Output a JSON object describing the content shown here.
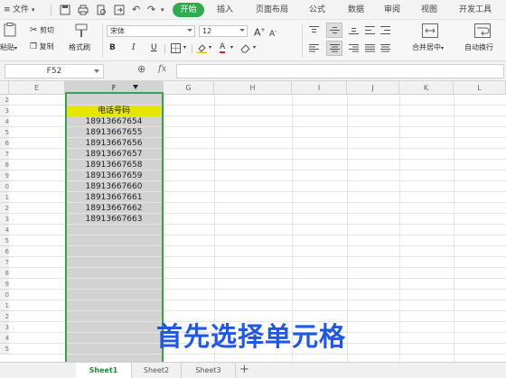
{
  "menubar": {
    "file": "文件",
    "tabs": [
      "开始",
      "插入",
      "页面布局",
      "公式",
      "数据",
      "审阅",
      "视图",
      "开发工具"
    ],
    "active_tab": "开始"
  },
  "ribbon": {
    "paste": "粘贴",
    "cut": "剪切",
    "copy": "复制",
    "format_painter": "格式刷",
    "font_name": "宋体",
    "font_size": "12",
    "grow_font": "A",
    "shrink_font": "A",
    "bold": "B",
    "italic": "I",
    "underline": "U",
    "font_color_label": "A",
    "merge_center": "合并居中",
    "auto_wrap": "自动换行"
  },
  "formula_bar": {
    "name_box": "F52",
    "fx": "fx",
    "formula": ""
  },
  "columns": [
    "E",
    "F",
    "G",
    "H",
    "I",
    "J",
    "K",
    "L"
  ],
  "selected_column": "F",
  "row_numbers": [
    "2",
    "3",
    "4",
    "5",
    "6",
    "7",
    "8",
    "9",
    "0",
    "1",
    "2",
    "3",
    "4",
    "5",
    "6",
    "7",
    "8",
    "9",
    "0",
    "1",
    "2",
    "3",
    "4",
    "5"
  ],
  "table": {
    "header": "电话号码",
    "phones": [
      "18913667654",
      "18913667655",
      "18913667656",
      "18913667657",
      "18913667658",
      "18913667659",
      "18913667660",
      "18913667661",
      "18913667662",
      "18913667663"
    ]
  },
  "subtitle": "首先选择单元格",
  "sheets": [
    "Sheet1",
    "Sheet2",
    "Sheet3"
  ],
  "active_sheet": "Sheet1",
  "add_sheet": "+",
  "colors": {
    "accent_green": "#2fad4e",
    "selection_border": "#36a24a",
    "header_highlight": "#e6e600",
    "subtitle_blue": "#1f58e6"
  }
}
